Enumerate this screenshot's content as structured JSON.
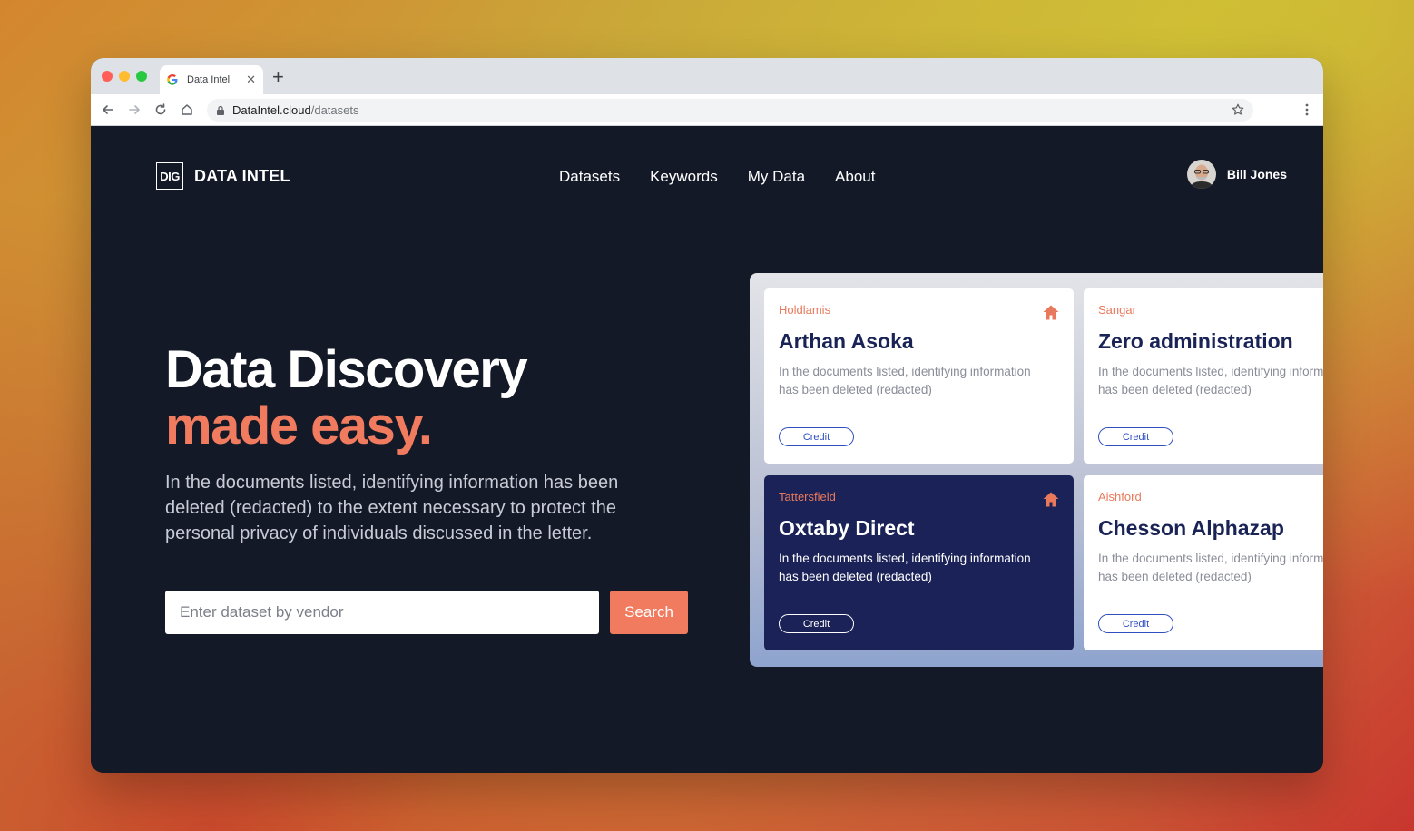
{
  "browser": {
    "tab_title": "Data Intel",
    "url_host": "DataIntel.cloud",
    "url_path": "/datasets"
  },
  "header": {
    "logo_text": "DIG",
    "brand": "DATA INTEL",
    "nav": [
      "Datasets",
      "Keywords",
      "My Data",
      "About"
    ],
    "user_name": "Bill Jones"
  },
  "hero": {
    "title_line1": "Data Discovery",
    "title_line2": "made easy.",
    "description": "In the documents listed, identifying information has been deleted (redacted) to the extent necessary to protect the personal privacy of individuals discussed in the letter.",
    "search_placeholder": "Enter dataset by vendor",
    "search_button": "Search"
  },
  "cards": [
    {
      "vendor": "Holdlamis",
      "title": "Arthan Asoka",
      "desc1": "In the documents listed, identifying information",
      "desc2": "has been deleted (redacted)",
      "badge": "Credit",
      "home_icon": true
    },
    {
      "vendor": "Sangar",
      "title": "Zero administration",
      "desc1": "In the documents listed, identifying information",
      "desc2": "has been deleted (redacted)",
      "badge": "Credit",
      "home_icon": false
    },
    {
      "vendor": "Tattersfield",
      "title": "Oxtaby Direct",
      "desc1": "In the documents listed, identifying information",
      "desc2": "has been deleted (redacted)",
      "badge": "Credit",
      "home_icon": true
    },
    {
      "vendor": "Aishford",
      "title": "Chesson Alphazap",
      "desc1": "In the documents listed, identifying information",
      "desc2": "has been deleted (redacted)",
      "badge": "Credit",
      "home_icon": false
    }
  ],
  "colors": {
    "accent": "#f07b5f",
    "page_bg": "#141927",
    "card_dark": "#1b2257",
    "title_navy": "#1a2355",
    "badge_blue": "#2f4fc0"
  }
}
